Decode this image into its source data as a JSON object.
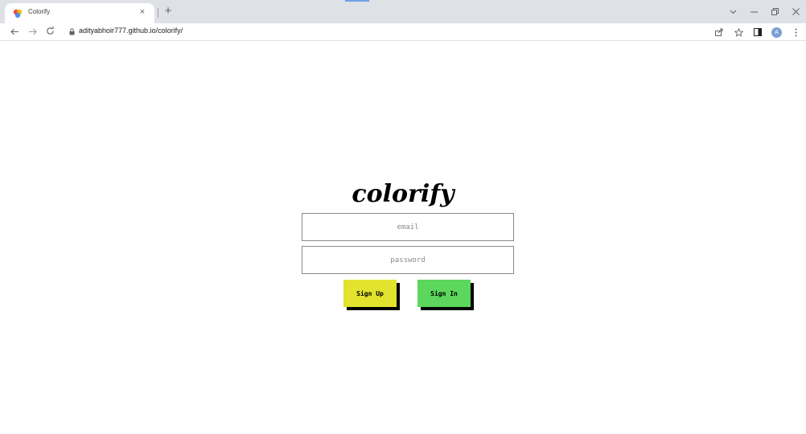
{
  "browser": {
    "tab_title": "Colorify",
    "tab_close": "×",
    "new_tab": "+",
    "url": "adityabhoir777.github.io/colorify/",
    "avatar_letter": "A",
    "icons": [
      "back-arrow-icon",
      "forward-arrow-icon",
      "reload-icon",
      "lock-icon",
      "share-icon",
      "star-icon",
      "side-panel-icon",
      "menu-icon"
    ]
  },
  "page": {
    "brand": "colorify",
    "email_placeholder": "email",
    "password_placeholder": "password",
    "signup_label": "Sign Up",
    "signin_label": "Sign In",
    "colors": {
      "signup": "#e2e32c",
      "signin": "#5cd65c",
      "shadow": "#000000"
    }
  }
}
